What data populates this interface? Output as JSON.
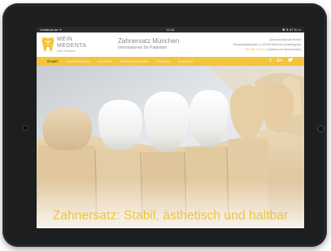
{
  "statusbar": {
    "carrier": "Vodafone.de ᯤ",
    "time": "11:24",
    "battery": "✱ ↯ 67 % ▭"
  },
  "brand": {
    "line1": "MEIN",
    "line2": "MEDENTA",
    "sub": "mein Zahnarzt",
    "accent_color": "#f2c53d"
  },
  "header": {
    "title": "Zahnersatz München",
    "subtitle": "Informationen für Patienten",
    "contact_name": "Zahnarzt Michael Riedel",
    "contact_address": "Rosenkavalierplatz 5 | 81925 München-Arabellapark",
    "contact_phone": "Tel: 089 917070",
    "contact_hours": "Anfahrt und Sprechzeiten"
  },
  "nav": {
    "items": [
      "START",
      "ZAHNERSATZ",
      "KOSTEN",
      "RATENZAHLUNG",
      "PRAXIS",
      "KONTAKT"
    ],
    "active_index": 0,
    "social": [
      {
        "icon": "facebook-icon",
        "glyph": "f"
      },
      {
        "icon": "google-plus-icon",
        "glyph": "G+"
      },
      {
        "icon": "twitter-icon",
        "glyph": "🐦"
      }
    ]
  },
  "hero": {
    "heading": "Zahnersatz: Stabil, ästhetisch und haltbar",
    "image": "dental-crowns-on-plaster-model"
  }
}
